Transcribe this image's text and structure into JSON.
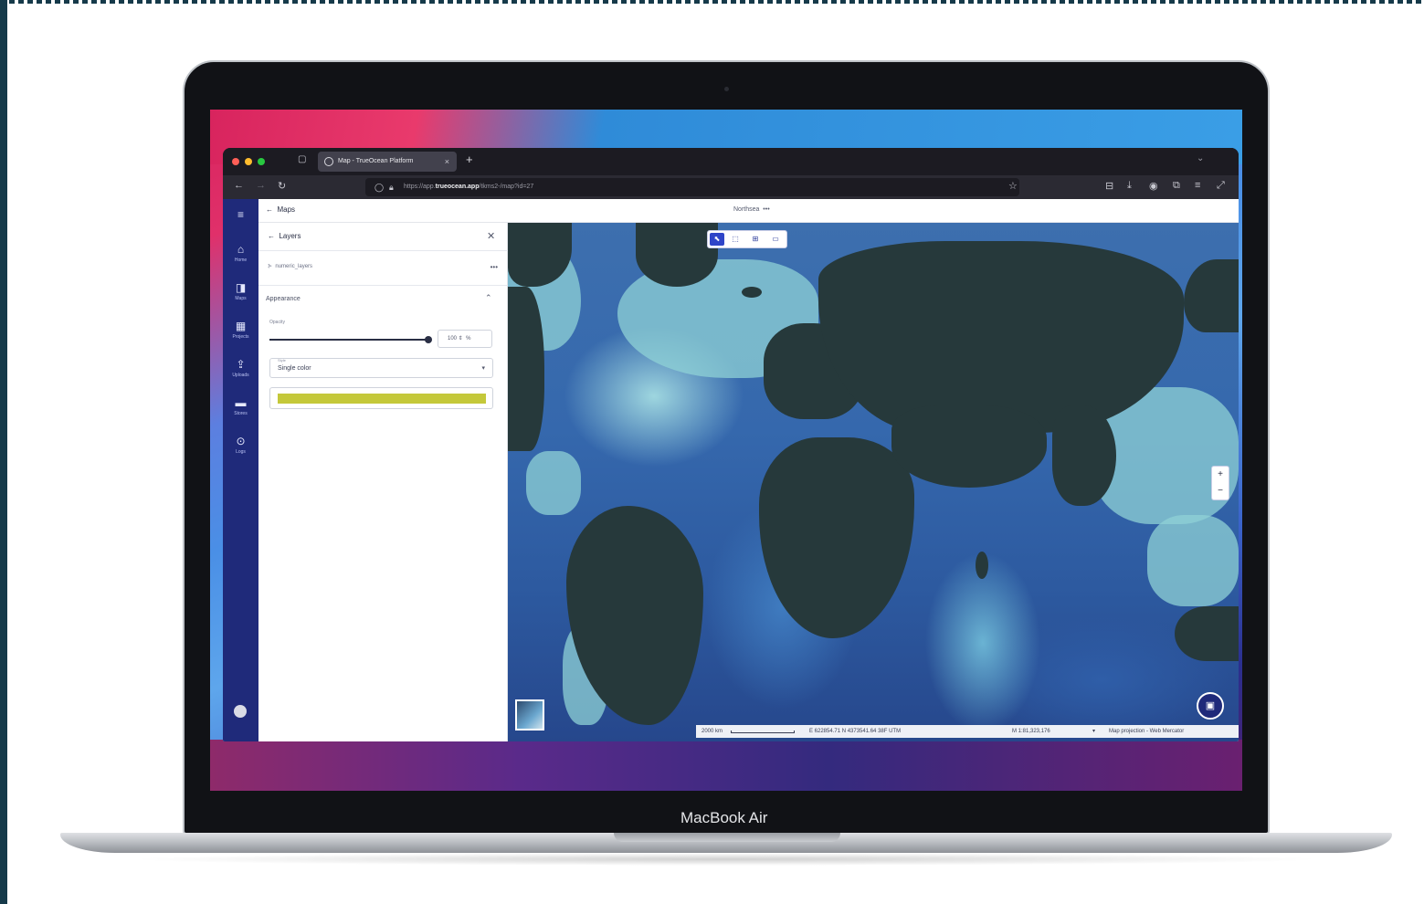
{
  "device": {
    "label": "MacBook Air"
  },
  "browser": {
    "tab_title": "Map - TrueOcean Platform",
    "tab_close": "×",
    "new_tab": "+",
    "url_prefix": "https://app.",
    "url_domain": "trueocean.app",
    "url_suffix": "/tkms2-/map?id=27"
  },
  "sidebar": {
    "menu_icon": "≡",
    "items": [
      {
        "icon": "home-icon",
        "glyph": "⌂",
        "label": "Home"
      },
      {
        "icon": "maps-icon",
        "glyph": "◨",
        "label": "Maps"
      },
      {
        "icon": "projects-icon",
        "glyph": "▦",
        "label": "Projects"
      },
      {
        "icon": "uploads-icon",
        "glyph": "⇪",
        "label": "Uploads"
      },
      {
        "icon": "stores-icon",
        "glyph": "▬",
        "label": "Stores"
      },
      {
        "icon": "logs-icon",
        "glyph": "⊙",
        "label": "Logs"
      }
    ]
  },
  "topbar": {
    "back_label": "Maps",
    "map_title": "Northsea",
    "more": "•••"
  },
  "panel": {
    "title": "Layers",
    "close": "✕",
    "layer_name": "numeric_layers",
    "layer_more": "•••",
    "section_title": "Appearance",
    "opacity_label": "Opacity",
    "opacity_value": "100",
    "opacity_unit": "%",
    "style_label": "Style",
    "style_value": "Single color",
    "layer_color": "#c4c83a"
  },
  "map": {
    "zoom_in": "+",
    "zoom_out": "−",
    "scale_text": "2000 km",
    "coordinates": "E 622854.71  N 4373541.64  38F  UTM",
    "map_scale": "M 1:81,323,176",
    "projection": "Map projection - Web Mercator"
  },
  "colors": {
    "sidebar": "#1f2a7a",
    "land": "#26393b",
    "ocean": "#3568ad",
    "shelf": "#8fd1d6",
    "accent": "#1f2a7a"
  }
}
